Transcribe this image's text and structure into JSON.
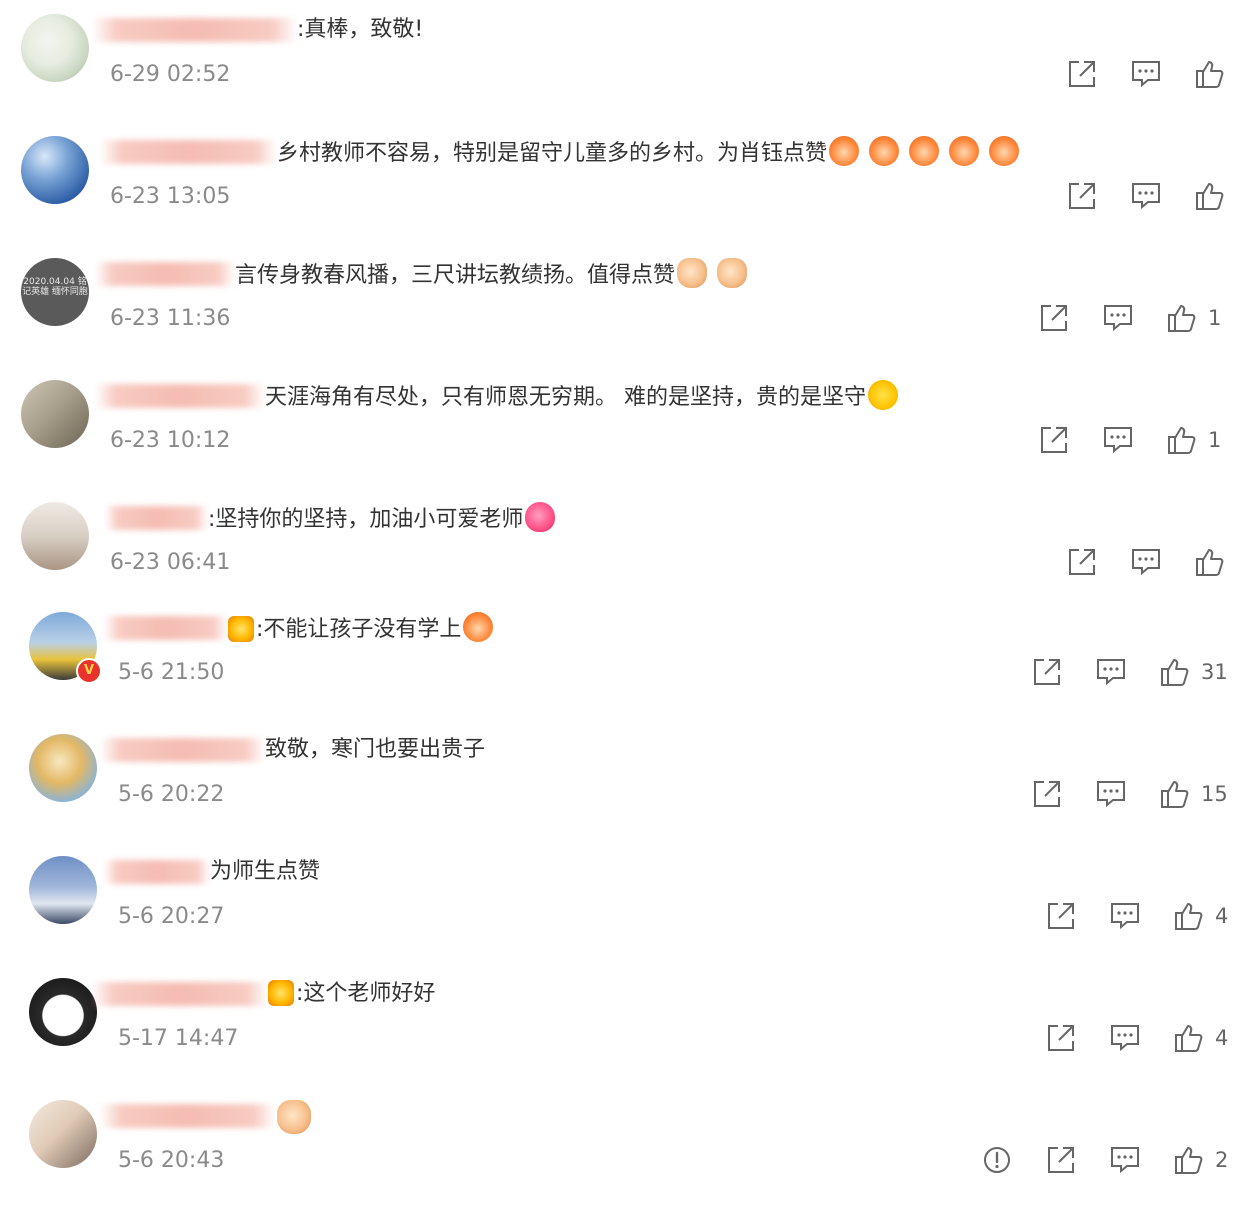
{
  "comments": [
    {
      "text": ":真棒，致敬!",
      "time": "6-29 02:52",
      "likes": ""
    },
    {
      "text": "乡村教师不容易，特别是留守儿童多的乡村。为肖钰点赞",
      "time": "6-23 13:05",
      "likes": ""
    },
    {
      "text": "言传身教春风播，三尺讲坛教绩扬。值得点赞",
      "time": "6-23 11:36",
      "likes": "1",
      "avatar_text": "2020.04.04 铭记英雄 缅怀同胞"
    },
    {
      "text": "天涯海角有尽处，只有师恩无穷期。 难的是坚持，贵的是坚守",
      "time": "6-23 10:12",
      "likes": "1"
    },
    {
      "text": ":坚持你的坚持，加油小可爱老师",
      "time": "6-23 06:41",
      "likes": ""
    },
    {
      "text": ":不能让孩子没有学上",
      "time": "5-6 21:50",
      "likes": "31",
      "badge": "V"
    },
    {
      "text": "致敬，寒门也要出贵子",
      "time": "5-6 20:22",
      "likes": "15"
    },
    {
      "text": "为师生点赞",
      "time": "5-6 20:27",
      "likes": "4"
    },
    {
      "text": ":这个老师好好",
      "time": "5-17 14:47",
      "likes": "4"
    },
    {
      "text": "",
      "time": "5-6 20:43",
      "likes": "2"
    }
  ],
  "icons": {
    "share": "share-icon",
    "comment": "comment-icon",
    "like": "thumbs-up-icon",
    "report": "report-icon"
  },
  "colors": {
    "text": "#333333",
    "time": "#8a8a8a",
    "icon": "#666666",
    "verified": "#e8322b"
  }
}
